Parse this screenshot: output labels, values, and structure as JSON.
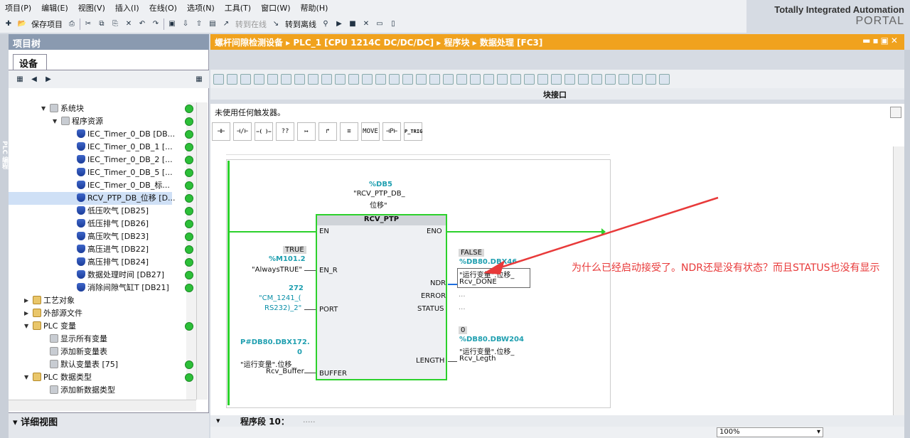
{
  "menu": [
    "项目(P)",
    "编辑(E)",
    "视图(V)",
    "插入(I)",
    "在线(O)",
    "选项(N)",
    "工具(T)",
    "窗口(W)",
    "帮助(H)"
  ],
  "brand": {
    "line1": "Totally Integrated Automation",
    "line2": "PORTAL"
  },
  "toolbar": {
    "save": "保存项目",
    "goto_online": "转到在线",
    "goto_offline": "转到离线"
  },
  "left": {
    "title": "项目树",
    "tab": "设备",
    "detail": "详细视图",
    "tree": [
      {
        "label": "系统块",
        "indent": 0,
        "expand": "▼",
        "icon": "gray",
        "dot": true
      },
      {
        "label": "程序资源",
        "indent": 1,
        "expand": "▼",
        "icon": "gray",
        "dot": true
      },
      {
        "label": "IEC_Timer_0_DB [DB...",
        "indent": 2,
        "icon": "db",
        "dot": true
      },
      {
        "label": "IEC_Timer_0_DB_1 [...",
        "indent": 2,
        "icon": "db",
        "dot": true
      },
      {
        "label": "IEC_Timer_0_DB_2 [...",
        "indent": 2,
        "icon": "db",
        "dot": true
      },
      {
        "label": "IEC_Timer_0_DB_5 [...",
        "indent": 2,
        "icon": "db",
        "dot": true
      },
      {
        "label": "IEC_Timer_0_DB_标...",
        "indent": 2,
        "icon": "db",
        "dot": true
      },
      {
        "label": "RCV_PTP_DB_位移 [D...",
        "indent": 2,
        "icon": "db",
        "dot": true,
        "sel": true
      },
      {
        "label": "低压吹气 [DB25]",
        "indent": 2,
        "icon": "db",
        "dot": true
      },
      {
        "label": "低压排气 [DB26]",
        "indent": 2,
        "icon": "db",
        "dot": true
      },
      {
        "label": "高压吹气 [DB23]",
        "indent": 2,
        "icon": "db",
        "dot": true
      },
      {
        "label": "高压进气 [DB22]",
        "indent": 2,
        "icon": "db",
        "dot": true
      },
      {
        "label": "高压排气 [DB24]",
        "indent": 2,
        "icon": "db",
        "dot": true
      },
      {
        "label": "数据处理时间 [DB27]",
        "indent": 2,
        "icon": "db",
        "dot": true
      },
      {
        "label": "消除间隙气缸T [DB21]",
        "indent": 2,
        "icon": "db",
        "dot": true
      },
      {
        "label": "工艺对象",
        "indent": -1,
        "expand": "▶",
        "icon": "fold",
        "dot": false
      },
      {
        "label": "外部源文件",
        "indent": -1,
        "expand": "▶",
        "icon": "fold",
        "dot": false
      },
      {
        "label": "PLC 变量",
        "indent": -1,
        "expand": "▼",
        "icon": "fold",
        "dot": true
      },
      {
        "label": "显示所有变量",
        "indent": 0,
        "icon": "gray",
        "dot": false
      },
      {
        "label": "添加新变量表",
        "indent": 0,
        "icon": "gray",
        "dot": false
      },
      {
        "label": "默认变量表 [75]",
        "indent": 0,
        "icon": "gray",
        "dot": true
      },
      {
        "label": "PLC 数据类型",
        "indent": -1,
        "expand": "▼",
        "icon": "fold",
        "dot": true
      },
      {
        "label": "添加新数据类型",
        "indent": 0,
        "icon": "gray",
        "dot": false
      }
    ]
  },
  "editor": {
    "breadcrumb": "螺杆间隙检测设备 ▸ PLC_1 [CPU 1214C DC/DC/DC] ▸ 程序块 ▸ 数据处理 [FC3]",
    "interface_label": "块接口",
    "trigger_text": "未使用任何触发器。",
    "ladder_buttons": [
      "⊣⊢",
      "⊣/⊢",
      "–( )–",
      "??",
      "↦",
      "↱",
      "≡",
      "MOVE",
      "⊣P⊢",
      "P_TRIG"
    ],
    "segment_title": "程序段 10：",
    "segment_dots": ".....",
    "zoom": "100%"
  },
  "block": {
    "db_addr": "%DB5",
    "db_name1": "\"RCV_PTP_DB_",
    "db_name2": "位移\"",
    "title": "RCV_PTP",
    "pins_left": {
      "en": "EN",
      "en_r": "EN_R",
      "port": "PORT",
      "buffer": "BUFFER"
    },
    "pins_right": {
      "eno": "ENO",
      "ndr": "NDR",
      "error": "ERROR",
      "status": "STATUS",
      "length": "LENGTH"
    },
    "en_r_val": "TRUE",
    "en_r_addr": "%M101.2",
    "en_r_name": "\"AlwaysTRUE\"",
    "port_val": "272",
    "port_name1": "\"CM_1241_(",
    "port_name2": "RS232)_2\"",
    "buf_addr1": "P#DB80.DBX172.",
    "buf_addr2": "0",
    "buf_name1": "\"运行变量\".位移_",
    "buf_name2": "Rcv_Buffer",
    "ndr_val": "FALSE",
    "ndr_addr": "%DB80.DBX46",
    "ndr_name1": "\"运行变量\".位移_",
    "ndr_name2": "Rcv_DONE",
    "error_val": "...",
    "status_val": "...",
    "len_val": "0",
    "len_addr": "%DB80.DBW204",
    "len_name1": "\"运行变量\".位移_",
    "len_name2": "Rcv_Legth"
  },
  "annotation": "为什么已经启动接受了。NDR还是没有状态？而且STATUS也没有显示",
  "colors": {
    "orange": "#f0a21e",
    "green": "#2cd12c",
    "red": "#e83a3a",
    "teal": "#1f9fb0"
  }
}
